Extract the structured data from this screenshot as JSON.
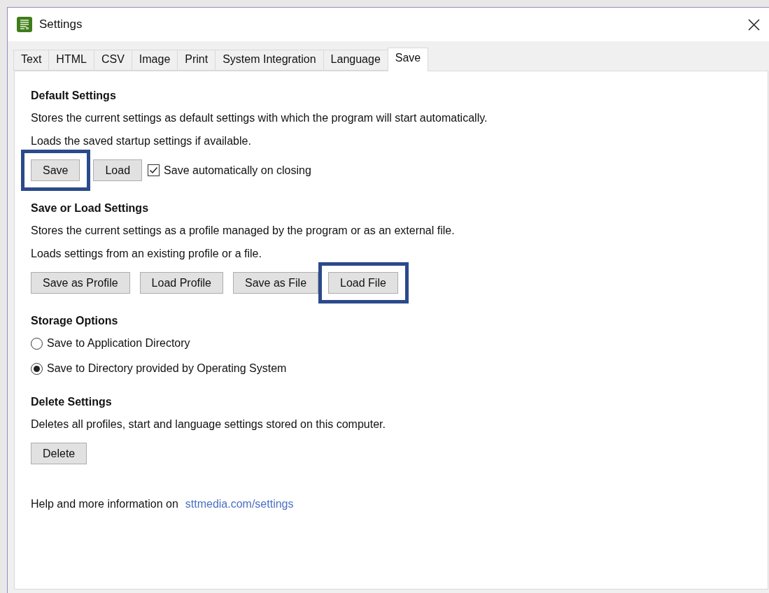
{
  "window": {
    "title": "Settings"
  },
  "tabs": [
    {
      "label": "Text",
      "selected": false
    },
    {
      "label": "HTML",
      "selected": false
    },
    {
      "label": "CSV",
      "selected": false
    },
    {
      "label": "Image",
      "selected": false
    },
    {
      "label": "Print",
      "selected": false
    },
    {
      "label": "System Integration",
      "selected": false
    },
    {
      "label": "Language",
      "selected": false
    },
    {
      "label": "Save",
      "selected": true
    }
  ],
  "sections": [
    {
      "heading": "Default Settings",
      "lines": [
        "Stores the current settings as default settings with which the program will start automatically.",
        "Loads the saved startup settings if available."
      ],
      "buttons": [
        {
          "label": "Save",
          "highlighted": true
        },
        {
          "label": "Load",
          "highlighted": false
        }
      ],
      "checkbox": {
        "label": "Save automatically on closing",
        "checked": true
      }
    },
    {
      "heading": "Save or Load Settings",
      "lines": [
        "Stores the current settings as a profile managed by the program or as an external file.",
        "Loads settings from an existing profile or a file."
      ],
      "buttons": [
        {
          "label": "Save as Profile",
          "highlighted": false
        },
        {
          "label": "Load Profile",
          "highlighted": false
        },
        {
          "label": "Save as File",
          "highlighted": false
        },
        {
          "label": "Load File",
          "highlighted": true
        }
      ]
    },
    {
      "heading": "Storage Options",
      "radios": [
        {
          "label": "Save to Application Directory",
          "selected": false
        },
        {
          "label": "Save to Directory provided by Operating System",
          "selected": true
        }
      ]
    },
    {
      "heading": "Delete Settings",
      "lines": [
        "Deletes all profiles, start and language settings stored on this computer."
      ],
      "buttons": [
        {
          "label": "Delete",
          "highlighted": false
        }
      ]
    }
  ],
  "help": {
    "text": "Help and more information on",
    "link": "sttmedia.com/settings"
  }
}
